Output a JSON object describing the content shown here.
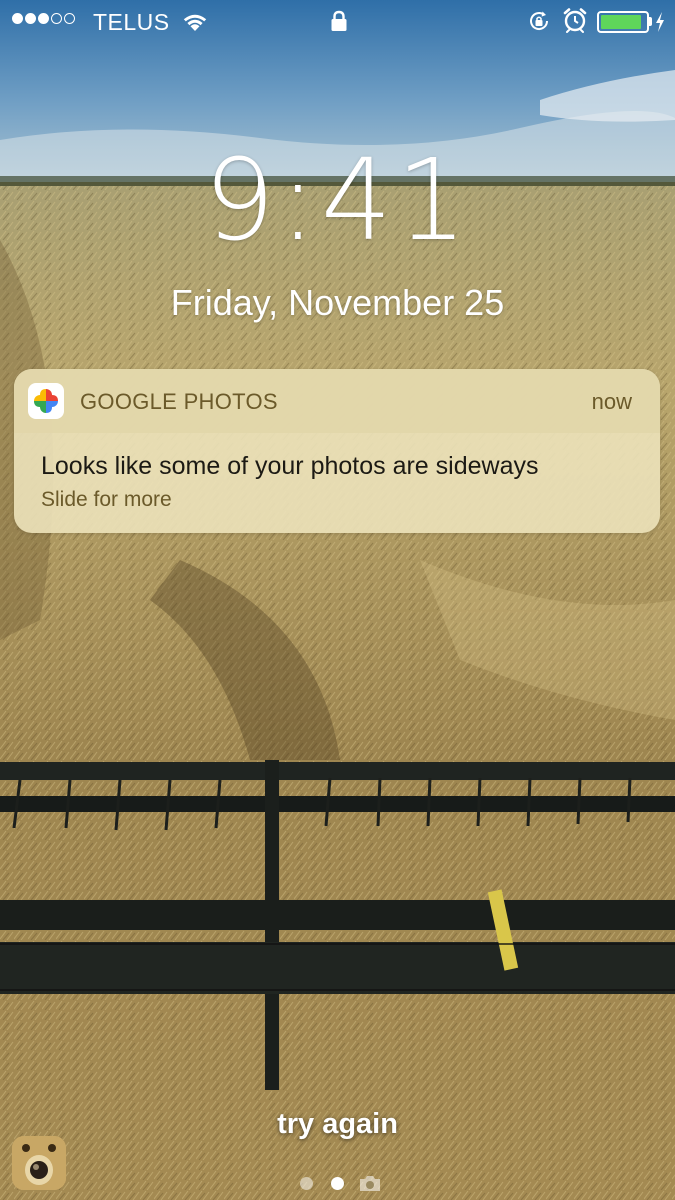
{
  "status_bar": {
    "carrier": "TELUS",
    "signal_bars_filled": 3,
    "signal_bars_total": 5,
    "battery_level": 0.9,
    "charging": true,
    "icons": [
      "wifi-icon",
      "lock-icon",
      "rotation-lock-icon",
      "alarm-icon",
      "battery-icon",
      "charging-bolt-icon"
    ]
  },
  "lock_screen": {
    "time": "9:41",
    "date": "Friday, November 25"
  },
  "notification": {
    "app_name": "GOOGLE PHOTOS",
    "timestamp": "now",
    "title": "Looks like some of your photos are sideways",
    "subtitle": "Slide for more",
    "icon": "google-photos-icon"
  },
  "bottom": {
    "hint": "try again",
    "page_count": 2,
    "current_page": 2,
    "icons": [
      "app-shortcut-icon",
      "camera-icon"
    ]
  },
  "colors": {
    "battery_fill": "#5fd65a",
    "notification_text_accent": "#6b5a2a"
  }
}
